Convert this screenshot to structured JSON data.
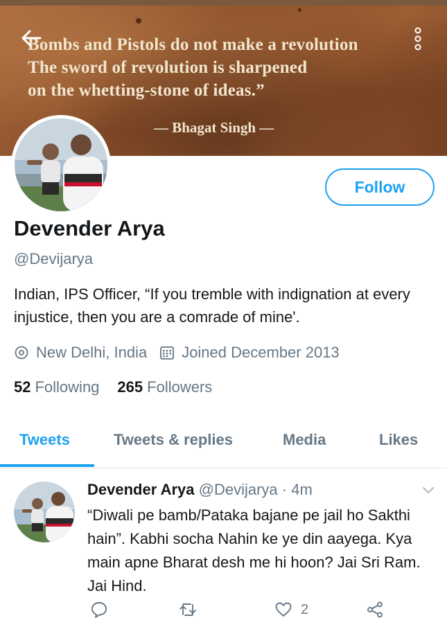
{
  "banner": {
    "quote_lines": [
      "Bombs and Pistols do not make a revolution",
      "The sword of revolution is sharpened",
      "on the whetting-stone of ideas.”"
    ],
    "attribution": "— Bhagat Singh —"
  },
  "profile": {
    "name": "Devender Arya",
    "handle": "@Devijarya",
    "bio": "Indian, IPS Officer, “If you tremble with indignation at every injustice, then you are a comrade of mine'.",
    "location": "New Delhi, India",
    "joined": "Joined December 2013",
    "following_count": "52",
    "following_label": "Following",
    "followers_count": "265",
    "followers_label": "Followers",
    "follow_label": "Follow"
  },
  "tabs": [
    {
      "label": "Tweets",
      "active": true
    },
    {
      "label": "Tweets & replies",
      "active": false
    },
    {
      "label": "Media",
      "active": false
    },
    {
      "label": "Likes",
      "active": false
    }
  ],
  "tweet": {
    "author_name": "Devender Arya",
    "author_handle": "@Devijarya",
    "separator": "·",
    "time": "4m",
    "text": "“Diwali pe bamb/Pataka bajane pe jail ho Sakthi hain”. Kabhi socha Nahin ke ye din aayega. Kya main apne Bharat desh me hi hoon? Jai Sri Ram. Jai Hind.",
    "like_count": "2"
  },
  "colors": {
    "accent": "#1da1f2",
    "secondary_text": "#657786",
    "primary_text": "#14171a",
    "divider": "#e1e8ed"
  },
  "icons": {
    "back": "back-arrow-icon",
    "more": "more-vertical-icon",
    "location": "location-pin-icon",
    "calendar": "calendar-icon",
    "caret": "chevron-down-icon",
    "reply": "reply-icon",
    "retweet": "retweet-icon",
    "like": "heart-icon",
    "share": "share-icon"
  }
}
